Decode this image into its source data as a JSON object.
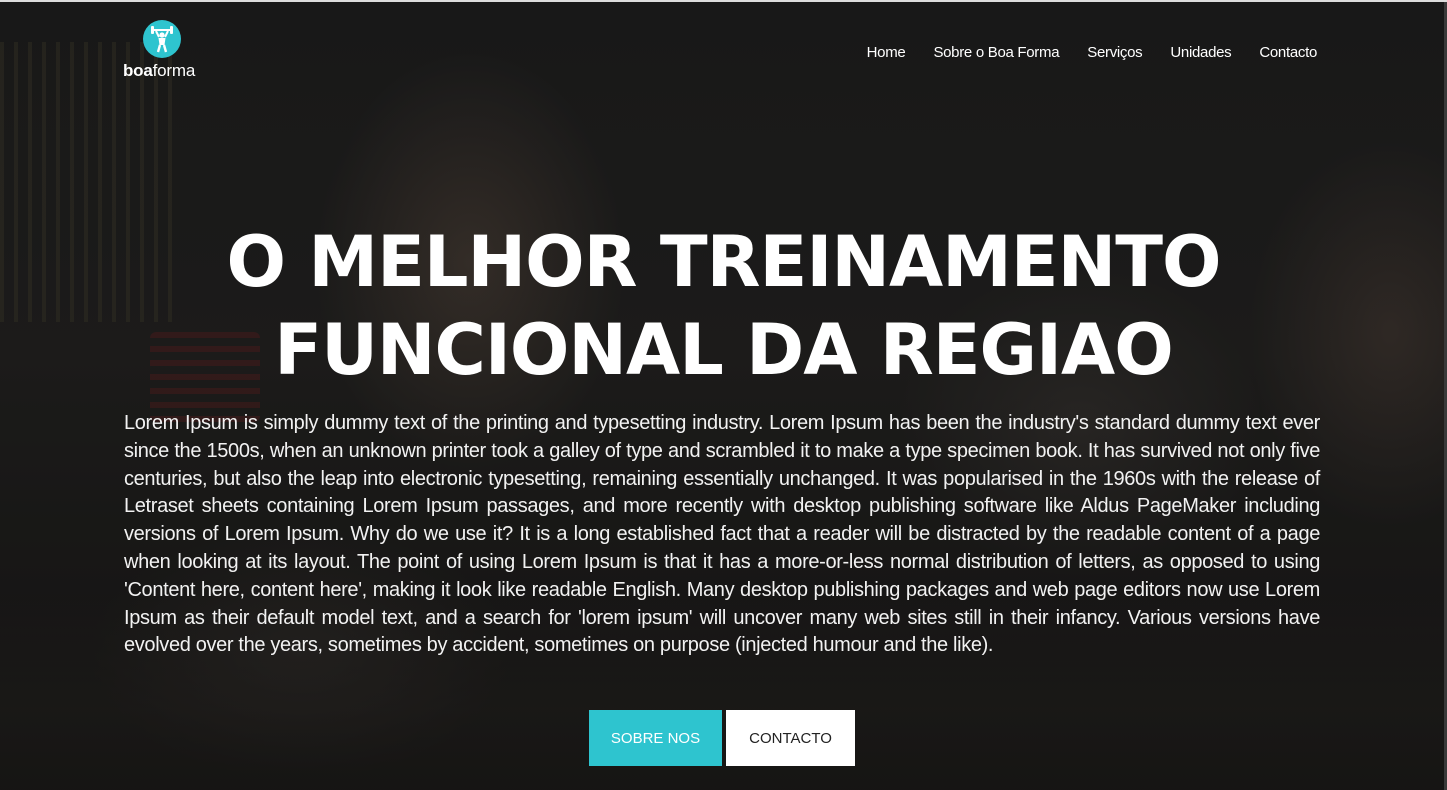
{
  "brand": {
    "name_bold": "boa",
    "name_regular": "forma",
    "accent_color": "#2ec4cf",
    "logo_icon": "weightlifter-icon"
  },
  "nav": {
    "items": [
      {
        "label": "Home"
      },
      {
        "label": "Sobre o Boa Forma"
      },
      {
        "label": "Serviços"
      },
      {
        "label": "Unidades"
      },
      {
        "label": "Contacto"
      }
    ]
  },
  "hero": {
    "headline_line1": "O MELHOR TREINAMENTO",
    "headline_line2": "FUNCIONAL DA REGIAO",
    "body": "Lorem Ipsum is simply dummy text of the printing and typesetting industry. Lorem Ipsum has been the industry's standard dummy text ever since the 1500s, when an unknown printer took a galley of type and scrambled it to make a type specimen book. It has survived not only five centuries, but also the leap into electronic typesetting, remaining essentially unchanged. It was popularised in the 1960s with the release of Letraset sheets containing Lorem Ipsum passages, and more recently with desktop publishing software like Aldus PageMaker including versions of Lorem Ipsum. Why do we use it? It is a long established fact that a reader will be distracted by the readable content of a page when looking at its layout. The point of using Lorem Ipsum is that it has a more-or-less normal distribution of letters, as opposed to using 'Content here, content here', making it look like readable English. Many desktop publishing packages and web page editors now use Lorem Ipsum as their default model text, and a search for 'lorem ipsum' will uncover many web sites still in their infancy. Various versions have evolved over the years, sometimes by accident, sometimes on purpose (injected humour and the like).",
    "primary_button": "SOBRE NOS",
    "secondary_button": "CONTACTO"
  }
}
